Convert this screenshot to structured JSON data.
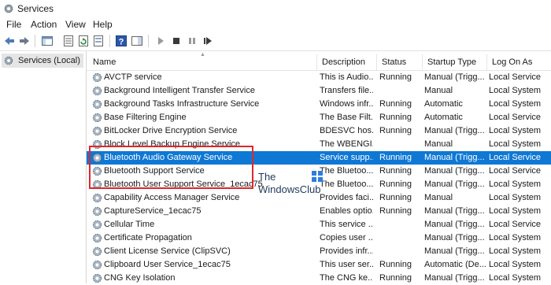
{
  "window": {
    "title": "Services"
  },
  "menu": [
    "File",
    "Action",
    "View",
    "Help"
  ],
  "tree": {
    "label": "Services (Local)"
  },
  "columns": {
    "name": "Name",
    "description": "Description",
    "status": "Status",
    "startup": "Startup Type",
    "logon": "Log On As"
  },
  "services": [
    {
      "name": "AVCTP service",
      "description": "This is Audio...",
      "status": "Running",
      "startup": "Manual (Trigg...",
      "logon": "Local Service",
      "selected": false
    },
    {
      "name": "Background Intelligent Transfer Service",
      "description": "Transfers file...",
      "status": "",
      "startup": "Manual",
      "logon": "Local System",
      "selected": false
    },
    {
      "name": "Background Tasks Infrastructure Service",
      "description": "Windows infr...",
      "status": "Running",
      "startup": "Automatic",
      "logon": "Local System",
      "selected": false
    },
    {
      "name": "Base Filtering Engine",
      "description": "The Base Filt...",
      "status": "Running",
      "startup": "Automatic",
      "logon": "Local Service",
      "selected": false
    },
    {
      "name": "BitLocker Drive Encryption Service",
      "description": "BDESVC hos...",
      "status": "Running",
      "startup": "Manual (Trigg...",
      "logon": "Local System",
      "selected": false
    },
    {
      "name": "Block Level Backup Engine Service",
      "description": "The WBENGI...",
      "status": "",
      "startup": "Manual",
      "logon": "Local System",
      "selected": false
    },
    {
      "name": "Bluetooth Audio Gateway Service",
      "description": "Service supp...",
      "status": "Running",
      "startup": "Manual (Trigg...",
      "logon": "Local Service",
      "selected": true
    },
    {
      "name": "Bluetooth Support Service",
      "description": "The Bluetoo...",
      "status": "Running",
      "startup": "Manual (Trigg...",
      "logon": "Local Service",
      "selected": false
    },
    {
      "name": "Bluetooth User Support Service_1ecac75",
      "description": "The Bluetoo...",
      "status": "Running",
      "startup": "Manual (Trigg...",
      "logon": "Local System",
      "selected": false
    },
    {
      "name": "Capability Access Manager Service",
      "description": "Provides faci...",
      "status": "Running",
      "startup": "Manual",
      "logon": "Local System",
      "selected": false
    },
    {
      "name": "CaptureService_1ecac75",
      "description": "Enables optio...",
      "status": "Running",
      "startup": "Manual (Trigg...",
      "logon": "Local System",
      "selected": false
    },
    {
      "name": "Cellular Time",
      "description": "This service ...",
      "status": "",
      "startup": "Manual (Trigg...",
      "logon": "Local Service",
      "selected": false
    },
    {
      "name": "Certificate Propagation",
      "description": "Copies user ...",
      "status": "",
      "startup": "Manual (Trigg...",
      "logon": "Local System",
      "selected": false
    },
    {
      "name": "Client License Service (ClipSVC)",
      "description": "Provides infr...",
      "status": "",
      "startup": "Manual (Trigg...",
      "logon": "Local System",
      "selected": false
    },
    {
      "name": "Clipboard User Service_1ecac75",
      "description": "This user ser...",
      "status": "Running",
      "startup": "Automatic (De...",
      "logon": "Local System",
      "selected": false
    },
    {
      "name": "CNG Key Isolation",
      "description": "The CNG ke...",
      "status": "Running",
      "startup": "Manual (Trigg...",
      "logon": "Local System",
      "selected": false
    }
  ],
  "watermark": {
    "line1": "The",
    "line2": "WindowsClub"
  },
  "colors": {
    "selection": "#0f78d4",
    "highlight_box": "#e0262b"
  }
}
